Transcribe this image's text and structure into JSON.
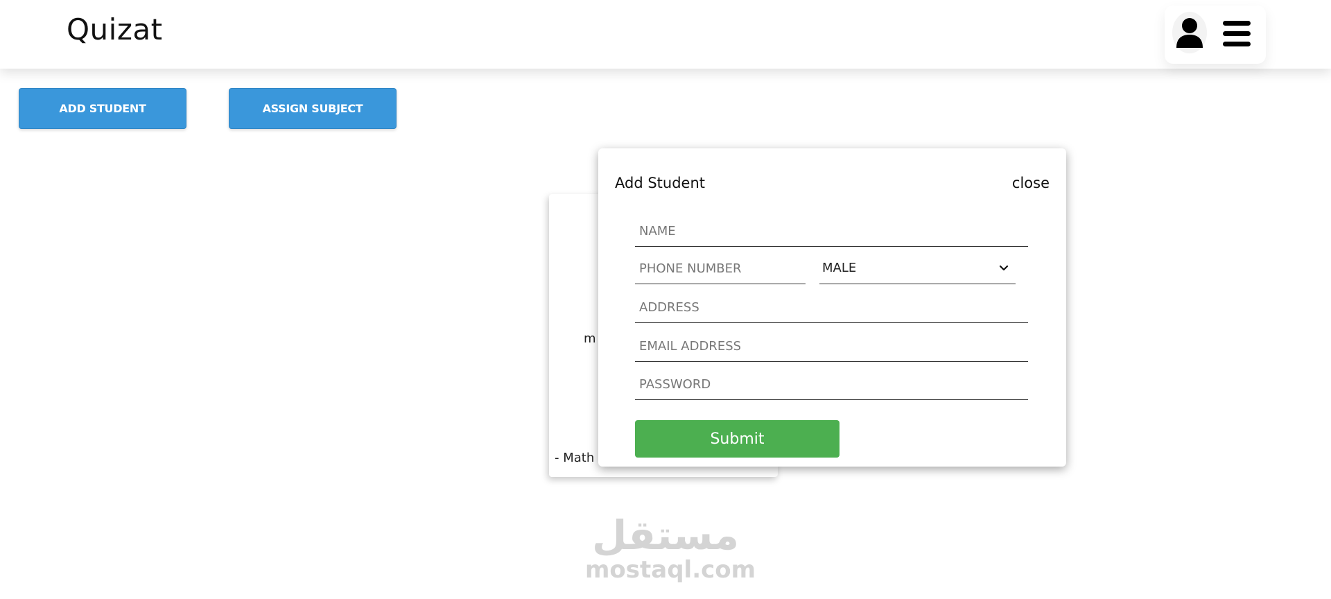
{
  "header": {
    "brand": "Quizat",
    "profile_icon": "user-icon",
    "menu_icon": "hamburger-menu-icon"
  },
  "actions": {
    "add_student": "ADD STUDENT",
    "assign_subject": "ASSIGN SUBJECT",
    "accent_color": "#3a97db"
  },
  "background_card": {
    "fragment_1": "m",
    "fragment_2": "- Math"
  },
  "modal": {
    "title": "Add Student",
    "close": "close",
    "fields": {
      "name": {
        "placeholder": "NAME",
        "value": ""
      },
      "phone": {
        "placeholder": "PHONE NUMBER",
        "value": ""
      },
      "gender": {
        "selected": "MALE"
      },
      "address": {
        "placeholder": "ADDRESS",
        "value": ""
      },
      "email": {
        "placeholder": "EMAIL ADDRESS",
        "value": ""
      },
      "password": {
        "placeholder": "PASSWORD",
        "value": ""
      }
    },
    "submit": "Submit",
    "submit_color": "#4caf50"
  },
  "watermark": {
    "arabic": "مستقل",
    "latin": "mostaql.com"
  }
}
